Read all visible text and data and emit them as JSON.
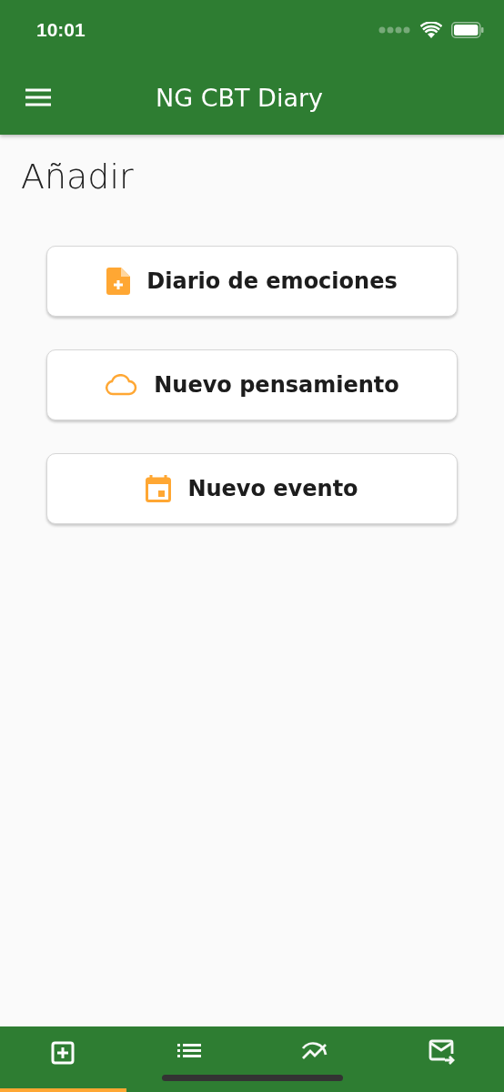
{
  "status_bar": {
    "time": "10:01"
  },
  "app_bar": {
    "title": "NG CBT Diary"
  },
  "page": {
    "heading": "Añadir"
  },
  "actions": [
    {
      "label": "Diario de emociones"
    },
    {
      "label": "Nuevo pensamiento"
    },
    {
      "label": "Nuevo evento"
    }
  ],
  "bottom_tabs": [
    {
      "selected": true
    },
    {
      "selected": false
    },
    {
      "selected": false
    },
    {
      "selected": false
    }
  ]
}
